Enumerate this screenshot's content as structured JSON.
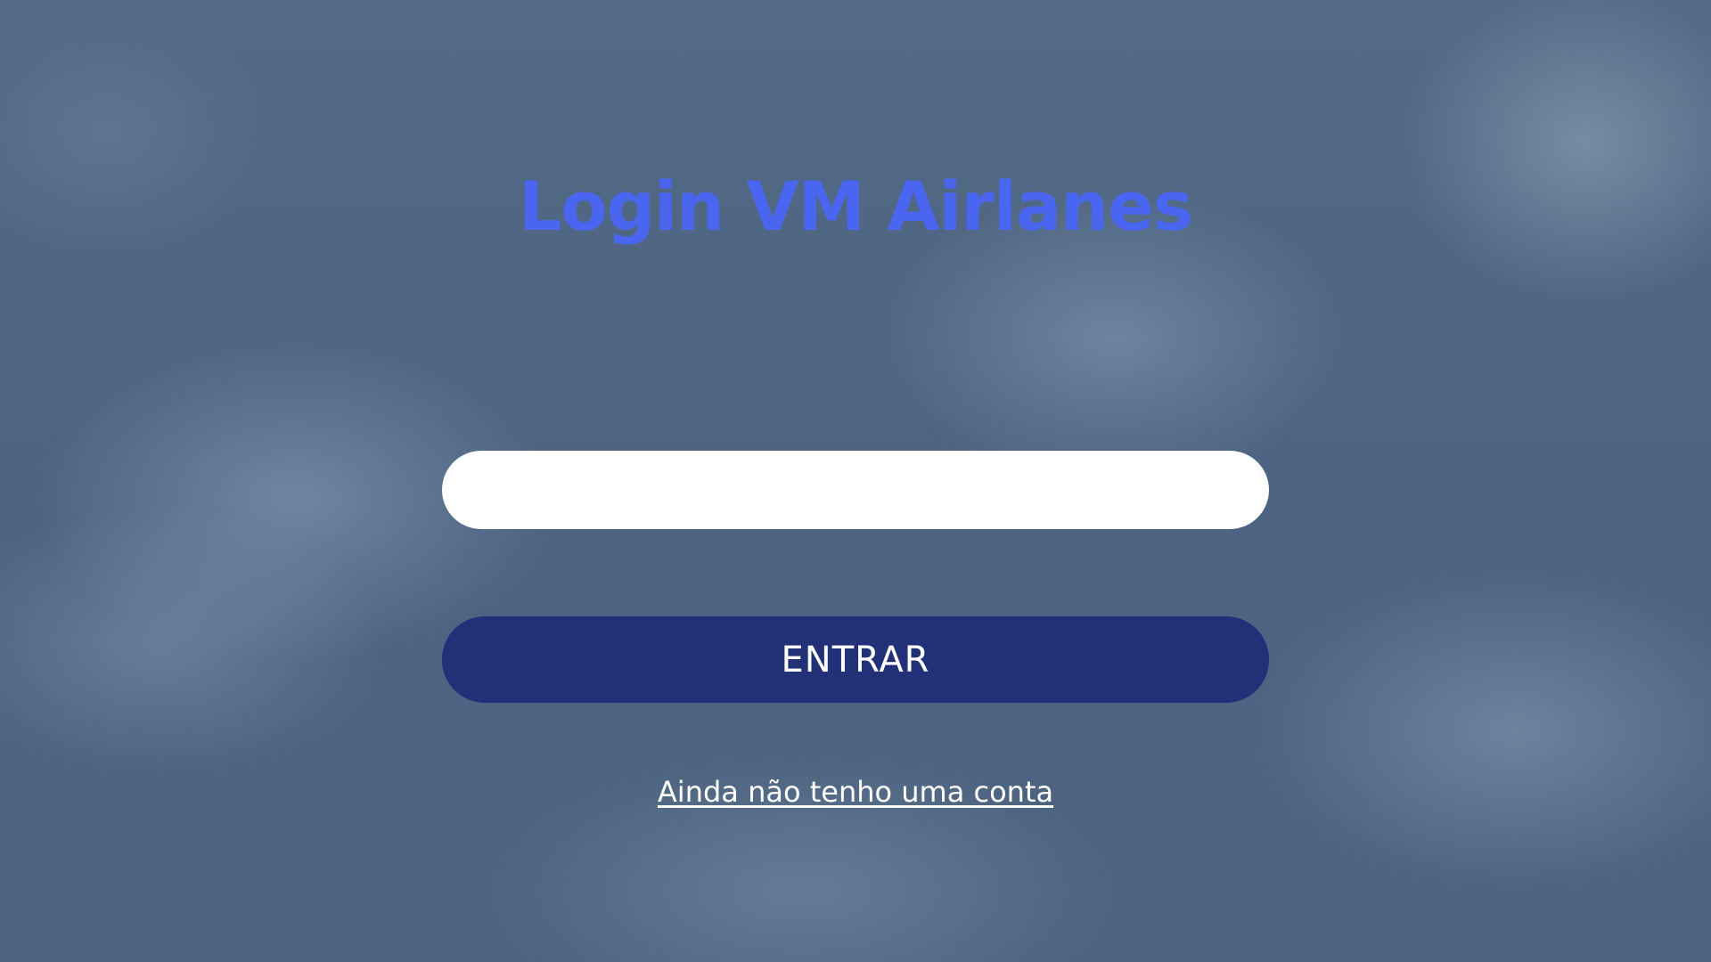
{
  "page": {
    "title": "Login VM Airlanes",
    "background": "cloudy-sky-image"
  },
  "login_form": {
    "input": {
      "value": "",
      "placeholder": ""
    },
    "submit_label": "ENTRAR",
    "signup_link_label": "Ainda não tenho uma conta"
  },
  "colors": {
    "title": "#4a66f0",
    "button_background": "#223078",
    "button_text": "#ffffff",
    "input_background": "#ffffff",
    "link": "#ffffff",
    "overlay": "#4f6580"
  }
}
